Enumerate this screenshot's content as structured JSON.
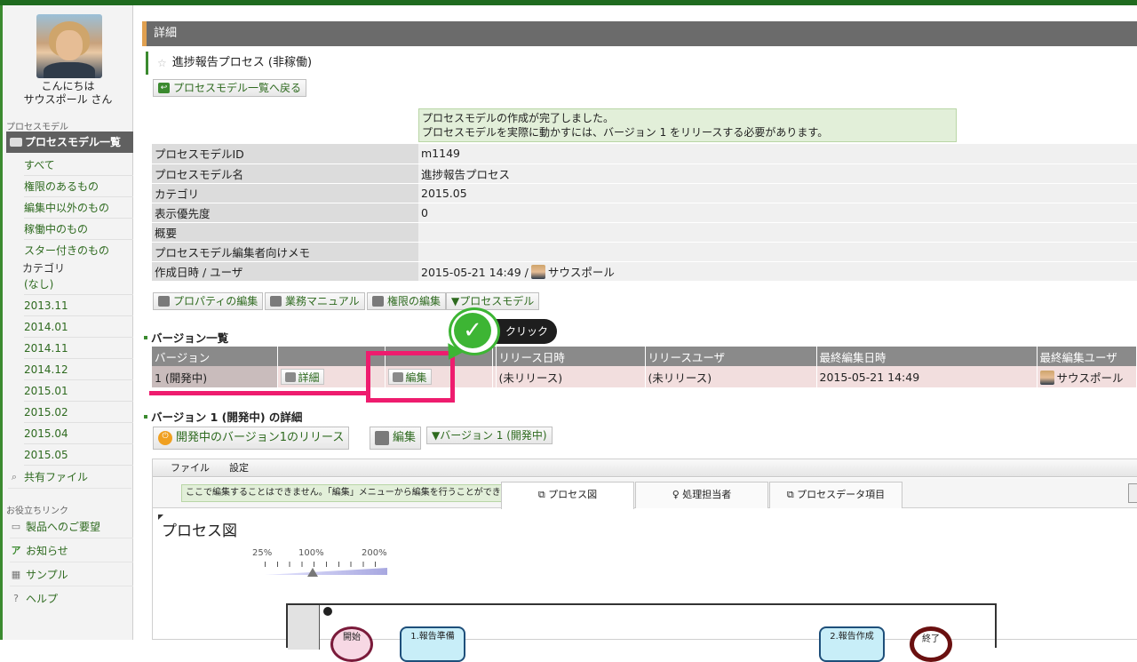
{
  "sidebar": {
    "greeting_line1": "こんにちは",
    "greeting_line2": "サウスポール さん",
    "section_process_model": "プロセスモデル",
    "active_item": "プロセスモデル一覧",
    "filters": [
      "すべて",
      "権限のあるもの",
      "編集中以外のもの",
      "稼働中のもの",
      "スター付きのもの"
    ],
    "category_label": "カテゴリ",
    "categories": [
      "(なし)",
      "2013.11",
      "2014.01",
      "2014.11",
      "2014.12",
      "2015.01",
      "2015.02",
      "2015.04",
      "2015.05"
    ],
    "shared_files": "共有ファイル",
    "useful_links_label": "お役立ちリンク",
    "links": [
      "製品へのご要望",
      "お知らせ",
      "サンプル",
      "ヘルプ"
    ]
  },
  "header": {
    "title": "詳細"
  },
  "process": {
    "title": "進捗報告プロセス (非稼働)",
    "back_button": "プロセスモデル一覧へ戻る",
    "notice_line1": "プロセスモデルの作成が完了しました。",
    "notice_line2": "プロセスモデルを実際に動かすには、バージョン 1 をリリースする必要があります。"
  },
  "properties": [
    {
      "key": "プロセスモデルID",
      "value": "m1149"
    },
    {
      "key": "プロセスモデル名",
      "value": "進捗報告プロセス"
    },
    {
      "key": "カテゴリ",
      "value": "2015.05"
    },
    {
      "key": "表示優先度",
      "value": "0"
    },
    {
      "key": "概要",
      "value": ""
    },
    {
      "key": "プロセスモデル編集者向けメモ",
      "value": ""
    },
    {
      "key": "作成日時 / ユーザ",
      "value": "2015-05-21 14:49 /",
      "user": "サウスポール"
    }
  ],
  "actions": {
    "edit_properties": "プロパティの編集",
    "manual": "業務マニュアル",
    "edit_permissions": "権限の編集",
    "process_model_menu": "▼プロセスモデル"
  },
  "versions": {
    "heading": "バージョン一覧",
    "columns": [
      "バージョン",
      "",
      "",
      "",
      "リリース日時",
      "リリースユーザ",
      "最終編集日時",
      "最終編集ユーザ"
    ],
    "row": {
      "version": "1 (開発中)",
      "detail_button": "詳細",
      "edit_button": "編集",
      "release_date": "(未リリース)",
      "release_user": "(未リリース)",
      "last_edit_date": "2015-05-21 14:49",
      "last_edit_user": "サウスポール"
    }
  },
  "callout": {
    "label": "クリック"
  },
  "version_detail": {
    "heading": "バージョン 1 (開発中) の詳細",
    "release_button": "開発中のバージョン1のリリース",
    "edit_button": "編集",
    "version_menu": "▼バージョン 1 (開発中)"
  },
  "editor": {
    "menu_file": "ファイル",
    "menu_settings": "設定",
    "note": "ここで編集することはできません。「編集」メニューから編集を行うことができます。",
    "tabs": [
      "プロセス図",
      "処理担当者",
      "プロセスデータ項目"
    ],
    "canvas_title": "プロセス図",
    "zoom_labels": [
      "25%",
      "100%",
      "200%"
    ],
    "nodes": [
      "開始",
      "1.報告準備",
      "2.報告作成",
      "終了"
    ]
  },
  "colors": {
    "accent_green": "#3b8a2f",
    "highlight_pink": "#ee1c6e",
    "callout_green": "#3db534"
  }
}
